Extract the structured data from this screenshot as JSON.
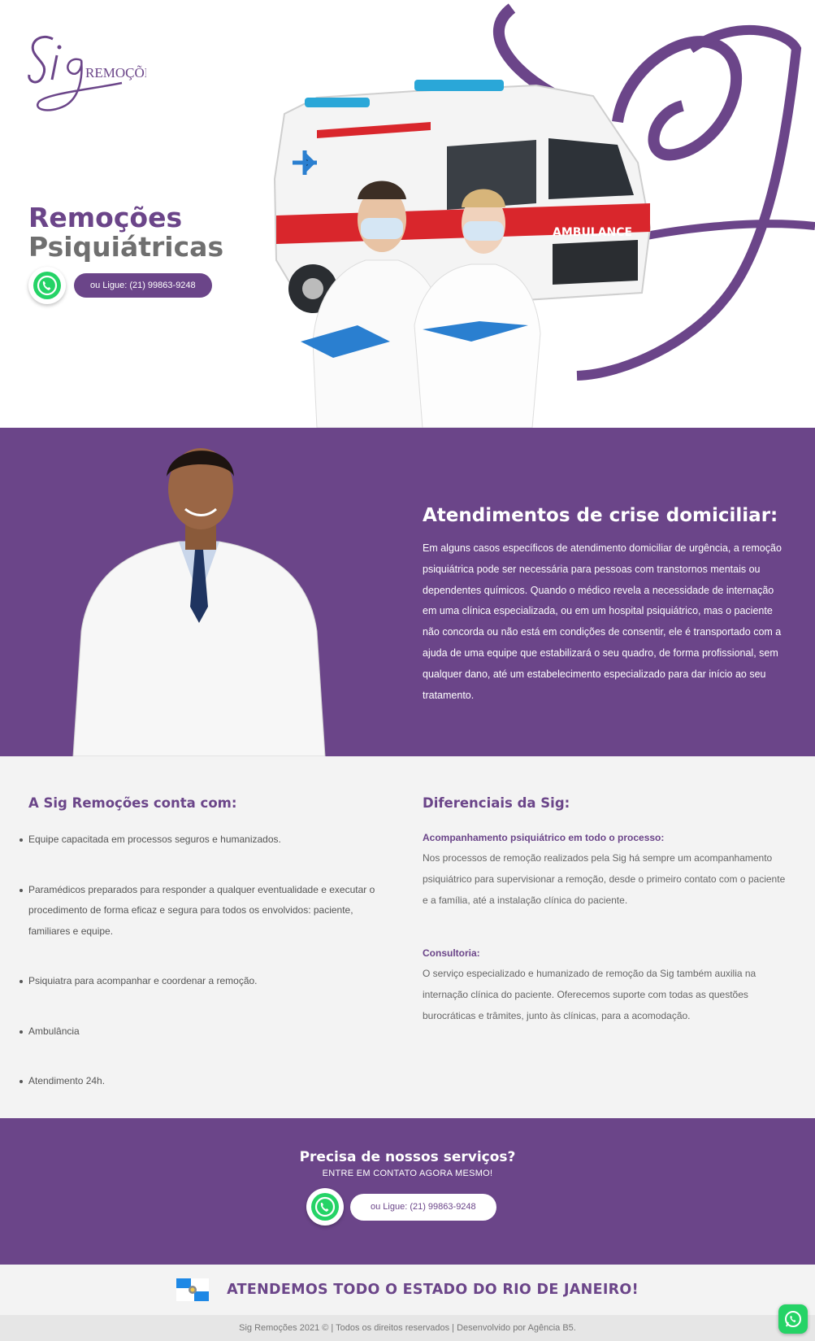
{
  "brand": {
    "logo_script": "Sig",
    "logo_word": "REMOÇÕES",
    "purple": "#6b4589",
    "grey": "#6f6f6f",
    "whatsapp_green": "#25d366"
  },
  "hero": {
    "title_line1": "Remoções",
    "title_line2": "Psiquiátricas",
    "phone_label": "ou Ligue: (21) 99863-9248",
    "whatsapp_icon": "whatsapp-icon",
    "ambulance_label": "AMBULANCE"
  },
  "crisis": {
    "heading": "Atendimentos de crise domiciliar:",
    "body": "Em alguns casos específicos de atendimento domiciliar de urgência, a remoção psiquiátrica pode ser necessária para pessoas com transtornos mentais ou dependentes químicos. Quando o médico revela a necessidade de internação em uma clínica especializada, ou em um hospital psiquiátrico, mas o paciente não concorda ou não está em condições de consentir, ele é transportado com a ajuda de uma equipe que estabilizará o seu quadro, de forma profissional, sem qualquer dano, até um estabelecimento especializado para dar início ao seu tratamento."
  },
  "features": {
    "left_heading": "A Sig Remoções conta com:",
    "items": [
      "Equipe capacitada em processos seguros e humanizados.",
      "Paramédicos preparados para responder a qualquer eventualidade e executar o procedimento de forma eficaz e segura para todos os envolvidos: paciente, familiares e equipe.",
      "Psiquiatra para acompanhar e coordenar a remoção.",
      "Ambulância",
      "Atendimento 24h."
    ],
    "right_heading": "Diferenciais da Sig:",
    "diff1_title": "Acompanhamento psiquiátrico em todo o processo:",
    "diff1_text": "Nos processos de remoção realizados pela Sig há sempre um acompanhamento psiquiátrico para supervisionar a remoção, desde o primeiro contato com o paciente e a família, até a instalação clínica do paciente.",
    "diff2_title": "Consultoria:",
    "diff2_text": "O serviço especializado e humanizado de remoção da Sig também auxilia na internação clínica do paciente. Oferecemos suporte com todas as questões burocráticas e trâmites, junto às clínicas, para a acomodação."
  },
  "cta": {
    "heading": "Precisa de nossos serviços?",
    "subheading": "ENTRE EM CONTATO AGORA MESMO!",
    "phone_label": "ou Ligue: (21) 99863-9248"
  },
  "state_banner": {
    "text": "ATENDEMOS TODO O ESTADO DO RIO DE JANEIRO!",
    "flag_icon": "rio-de-janeiro-flag-icon"
  },
  "footer": {
    "text": "Sig Remoções 2021 © | Todos os direitos reservados | Desenvolvido por Agência B5."
  }
}
